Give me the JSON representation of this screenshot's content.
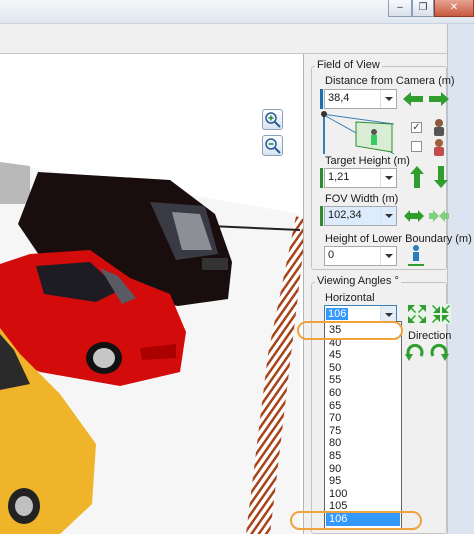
{
  "window": {
    "minimize_glyph": "–",
    "restore_glyph": "❐",
    "close_glyph": "✕"
  },
  "viewport": {
    "zoom_in_icon": "magnifier-plus-icon",
    "zoom_out_icon": "magnifier-minus-icon"
  },
  "field_of_view": {
    "title": "Field of View",
    "distance_label": "Distance from Camera  (m)",
    "distance_value": "38,4",
    "distance_accent_color": "#1f6fae",
    "show_camera_checked": true,
    "show_person_checked": false,
    "target_height_label": "Target Height (m)",
    "target_height_value": "1,21",
    "target_height_accent_color": "#2e8b2e",
    "fov_width_label": "FOV Width (m)",
    "fov_width_value": "102,34",
    "fov_width_accent_color": "#2e8b2e",
    "lower_boundary_label": "Height of Lower Boundary (m)",
    "lower_boundary_value": "0"
  },
  "viewing_angles": {
    "title": "Viewing Angles °",
    "horizontal_label": "Horizontal",
    "horizontal_value": "106",
    "direction_label": "Direction",
    "options": [
      "35",
      "40",
      "45",
      "50",
      "55",
      "60",
      "65",
      "70",
      "75",
      "80",
      "85",
      "90",
      "95",
      "100",
      "105",
      "106"
    ],
    "selected_option": "106"
  },
  "colors": {
    "arrow_green": "#2f9e2f",
    "selection_blue": "#3399ff",
    "highlight_orange": "#f0a23c"
  }
}
